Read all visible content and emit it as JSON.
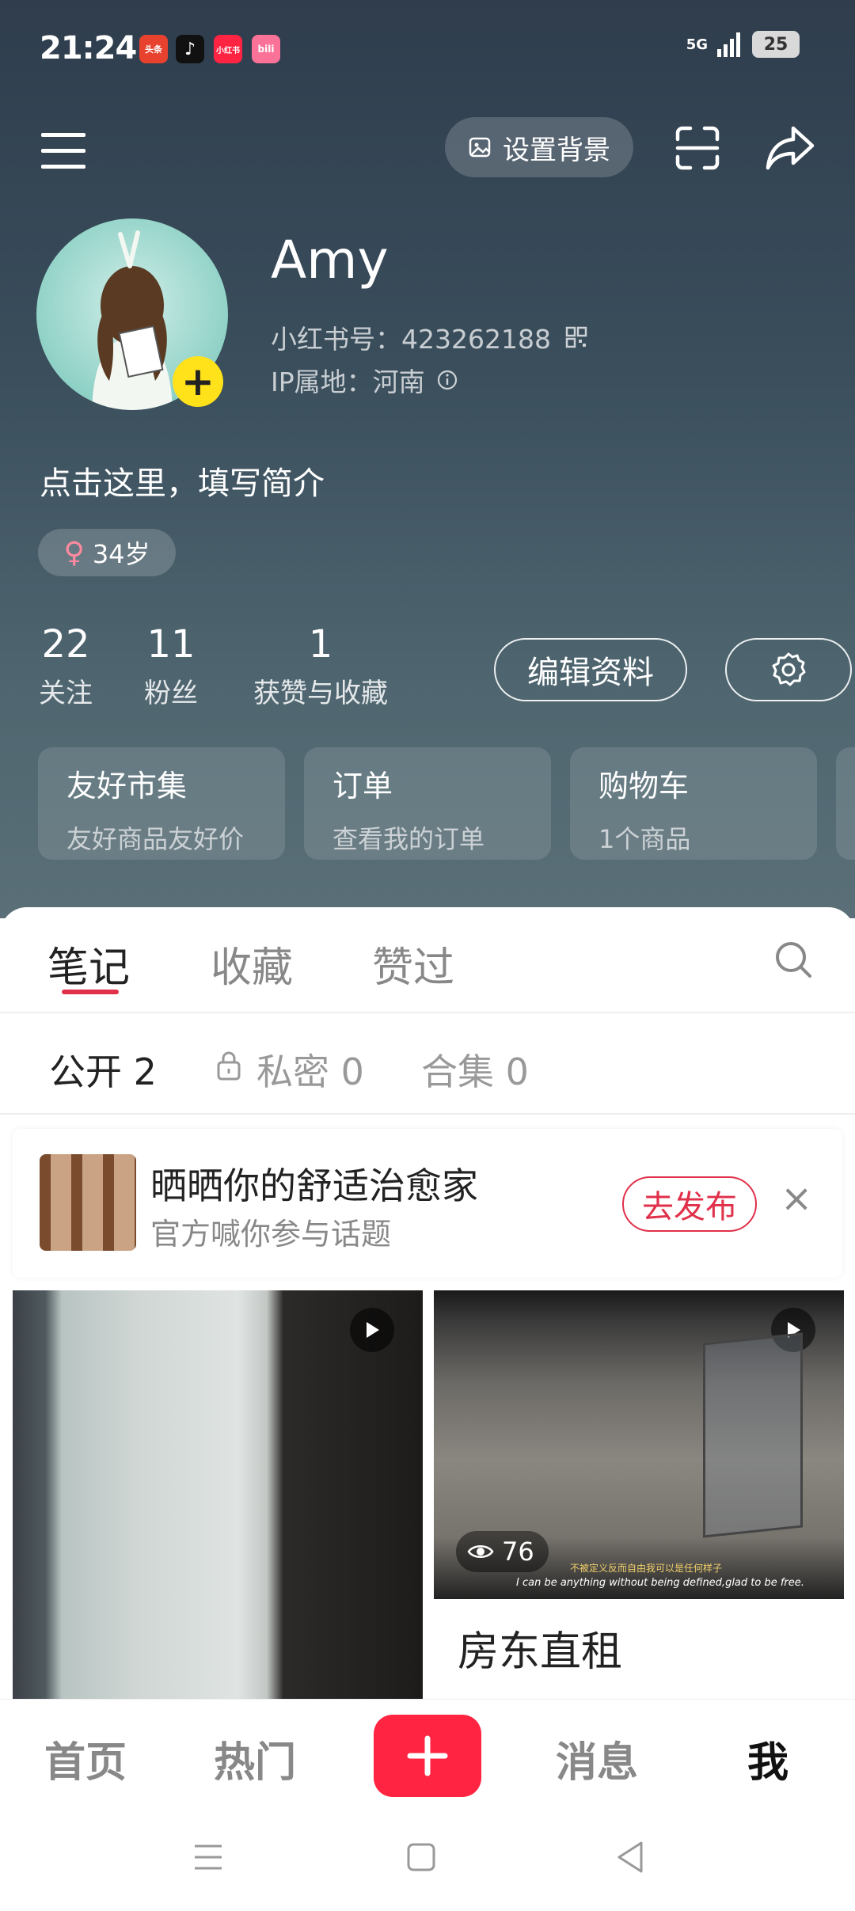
{
  "status_bar": {
    "time": "21:24",
    "apps": [
      {
        "label": "头条",
        "color": "#e8422f"
      },
      {
        "label": "♪",
        "color": "#111111"
      },
      {
        "label": "小红书",
        "color": "#ff2442"
      },
      {
        "label": "bili",
        "color": "#fb7299"
      }
    ],
    "network": "5G",
    "battery": "25"
  },
  "toolbar": {
    "set_background_label": "设置背景"
  },
  "profile": {
    "name": "Amy",
    "id_label": "小红书号：423262188",
    "ip_label": "IP属地：河南",
    "bio_placeholder": "点击这里，填写简介",
    "gender_symbol": "♀",
    "age": "34岁"
  },
  "stats": [
    {
      "value": "22",
      "label": "关注"
    },
    {
      "value": "11",
      "label": "粉丝"
    },
    {
      "value": "1",
      "label": "获赞与收藏"
    }
  ],
  "actions": {
    "edit_profile_label": "编辑资料"
  },
  "cards": [
    {
      "title": "友好市集",
      "subtitle": "友好商品友好价"
    },
    {
      "title": "订单",
      "subtitle": "查看我的订单"
    },
    {
      "title": "购物车",
      "subtitle": "1个商品"
    }
  ],
  "tabs": [
    {
      "label": "笔记",
      "active": true
    },
    {
      "label": "收藏",
      "active": false
    },
    {
      "label": "赞过",
      "active": false
    }
  ],
  "subtabs": [
    {
      "label": "公开 2",
      "active": true
    },
    {
      "label": "私密 0",
      "active": false
    },
    {
      "label": "合集 0",
      "active": false
    }
  ],
  "promo": {
    "title": "晒晒你的舒适治愈家",
    "subtitle": "官方喊你参与话题",
    "button_label": "去发布"
  },
  "notes": [
    {
      "title": ""
    },
    {
      "title": "房东直租",
      "views": "76",
      "subtitle_cn": "不被定义反而自由我可以是任何样子",
      "subtitle_en": "I can be anything without being defined,glad to be free."
    }
  ],
  "bottom_nav": [
    {
      "label": "首页",
      "active": false
    },
    {
      "label": "热门",
      "active": false
    },
    {
      "label": "消息",
      "active": false
    },
    {
      "label": "我",
      "active": true
    }
  ],
  "colors": {
    "accent": "#ff2442",
    "underline": "#e0304a",
    "avatar_badge": "#ffe21a"
  }
}
